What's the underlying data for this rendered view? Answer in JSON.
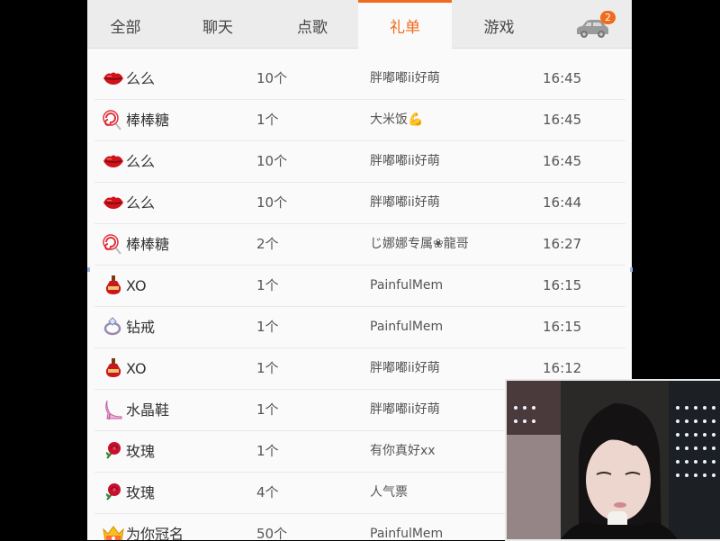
{
  "tabs": [
    {
      "label": "全部"
    },
    {
      "label": "聊天"
    },
    {
      "label": "点歌"
    },
    {
      "label": "礼单"
    },
    {
      "label": "游戏"
    }
  ],
  "active_tab": "礼单",
  "car_badge": "2",
  "accent_color": "#f26a1b",
  "gifts": [
    {
      "icon": "lips-icon",
      "name": "么么",
      "qty": "10个",
      "user": "胖嘟嘟ii好萌",
      "time": "16:45"
    },
    {
      "icon": "lollipop-icon",
      "name": "棒棒糖",
      "qty": "1个",
      "user": "大米饭💪",
      "time": "16:45"
    },
    {
      "icon": "lips-icon",
      "name": "么么",
      "qty": "10个",
      "user": "胖嘟嘟ii好萌",
      "time": "16:45"
    },
    {
      "icon": "lips-icon",
      "name": "么么",
      "qty": "10个",
      "user": "胖嘟嘟ii好萌",
      "time": "16:44"
    },
    {
      "icon": "lollipop-icon",
      "name": "棒棒糖",
      "qty": "2个",
      "user": "じ娜娜专属❀龍哥",
      "time": "16:27"
    },
    {
      "icon": "xo-bottle-icon",
      "name": "XO",
      "qty": "1个",
      "user": "PainfulMem",
      "time": "16:15"
    },
    {
      "icon": "ring-icon",
      "name": "钻戒",
      "qty": "1个",
      "user": "PainfulMem",
      "time": "16:15"
    },
    {
      "icon": "xo-bottle-icon",
      "name": "XO",
      "qty": "1个",
      "user": "胖嘟嘟ii好萌",
      "time": "16:12"
    },
    {
      "icon": "crystal-shoe-icon",
      "name": "水晶鞋",
      "qty": "1个",
      "user": "胖嘟嘟ii好萌",
      "time": ""
    },
    {
      "icon": "rose-icon",
      "name": "玫瑰",
      "qty": "1个",
      "user": "有你真好xx",
      "time": ""
    },
    {
      "icon": "rose-icon",
      "name": "玫瑰",
      "qty": "4个",
      "user": "人气票",
      "time": ""
    },
    {
      "icon": "crown-icon",
      "name": "为你冠名",
      "qty": "50个",
      "user": "PainfulMem",
      "time": ""
    }
  ]
}
